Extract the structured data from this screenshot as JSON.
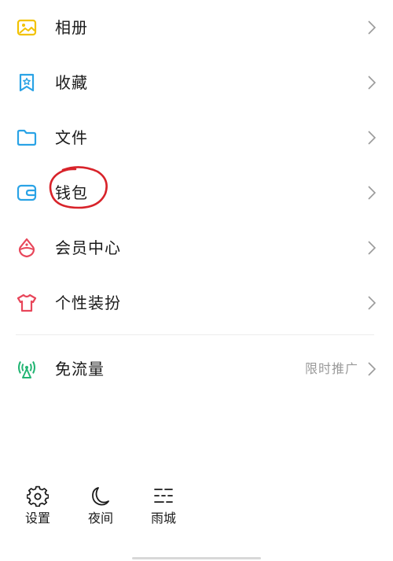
{
  "menu": {
    "items": [
      {
        "label": "相册",
        "icon": "photo-album-icon",
        "color": "#f2c200"
      },
      {
        "label": "收藏",
        "icon": "favorites-icon",
        "color": "#2aa3e6"
      },
      {
        "label": "文件",
        "icon": "folder-icon",
        "color": "#2aa3e6"
      },
      {
        "label": "钱包",
        "icon": "wallet-icon",
        "color": "#2aa3e6"
      },
      {
        "label": "会员中心",
        "icon": "vip-diamond-icon",
        "color": "#e8465a"
      },
      {
        "label": "个性装扮",
        "icon": "tshirt-icon",
        "color": "#e8465a"
      }
    ],
    "free_data": {
      "label": "免流量",
      "hint": "限时推广",
      "icon": "signal-tower-icon",
      "color": "#22b573"
    }
  },
  "bottom": {
    "settings_label": "设置",
    "night_label": "夜间",
    "weather_label": "雨城"
  },
  "colors": {
    "annotation_circle": "#d8232a",
    "chevron": "#9a9a9a"
  }
}
